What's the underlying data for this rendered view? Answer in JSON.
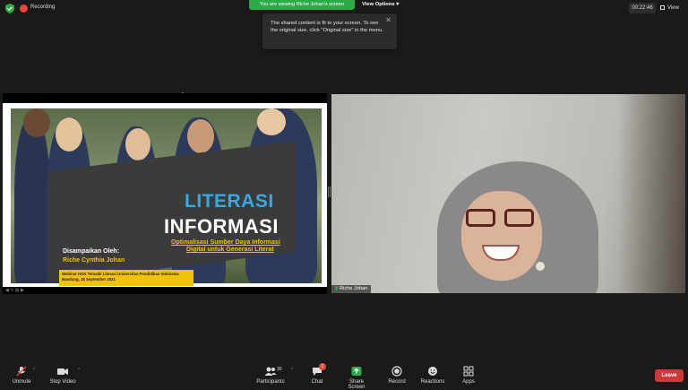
{
  "topbar": {
    "recording_label": "Recording",
    "viewing_banner": "You are viewing Riche Johan's screen",
    "view_options_label": "View Options",
    "timer": "00:22:46",
    "view_label": "View"
  },
  "tooltip": {
    "message": "The shared content is fit to your screen. To see the original size, click \"Original size\" in the menu."
  },
  "slide": {
    "title_line1": "LITERASI",
    "title_line2": "INFORMASI",
    "subtitle_line1": "Optimalisasi Sumber Daya Informasi",
    "subtitle_line2": "Digital untuk Generasi Literat",
    "presented_by": "Disampaikan Oleh:",
    "presenter": "Riche Cynthia Johan",
    "webinar_line1": "Webinar KKN Tematik Literasi Universitas Pendidikan Indonesia",
    "webinar_line2": "Bandung, 18 September 2021"
  },
  "video": {
    "participant_name": "Riche Johan"
  },
  "toolbar": {
    "unmute": "Unmute",
    "stop_video": "Stop Video",
    "participants": "Participants",
    "participants_count": "30",
    "chat": "Chat",
    "chat_badge": "1",
    "share_screen": "Share Screen",
    "record": "Record",
    "reactions": "Reactions",
    "apps": "Apps",
    "leave": "Leave"
  },
  "colors": {
    "share_green": "#2dab49",
    "leave_red": "#d1363b",
    "slide_title_blue": "#3aa8e0",
    "slide_accent_yellow": "#f0c400"
  }
}
